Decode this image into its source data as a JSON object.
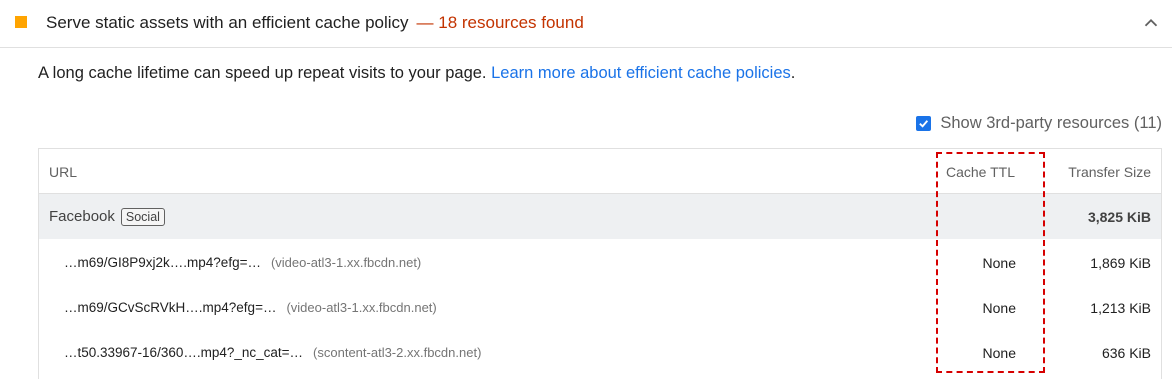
{
  "audit": {
    "title": "Serve static assets with an efficient cache policy",
    "display_value": "— 18 resources found",
    "description": "A long cache lifetime can speed up repeat visits to your page.",
    "learn_more_link": "Learn more about efficient cache policies",
    "description_end": ".",
    "third_party_label": "Show 3rd-party resources (11)"
  },
  "table": {
    "headers": {
      "url": "URL",
      "cache_ttl": "Cache TTL",
      "transfer_size": "Transfer Size"
    },
    "group": {
      "entity": "Facebook",
      "badge": "Social",
      "total": "3,825 KiB"
    },
    "rows": [
      {
        "url": "…m69/GI8P9xj2k….mp4?efg=…",
        "origin": "(video-atl3-1.xx.fbcdn.net)",
        "ttl": "None",
        "size": "1,869 KiB"
      },
      {
        "url": "…m69/GCvScRVkH….mp4?efg=…",
        "origin": "(video-atl3-1.xx.fbcdn.net)",
        "ttl": "None",
        "size": "1,213 KiB"
      },
      {
        "url": "…t50.33967-16/360….mp4?_nc_cat=…",
        "origin": "(scontent-atl3-2.xx.fbcdn.net)",
        "ttl": "None",
        "size": "636 KiB"
      }
    ]
  },
  "colors": {
    "warning_marker": "#ffa400",
    "display_value": "#c33300",
    "link": "#1a73e8",
    "highlight": "#d60000"
  },
  "icons": {
    "marker": "square-warning-icon",
    "toggle": "chevron-up-icon",
    "checkbox": "checkbox-checked-icon"
  }
}
